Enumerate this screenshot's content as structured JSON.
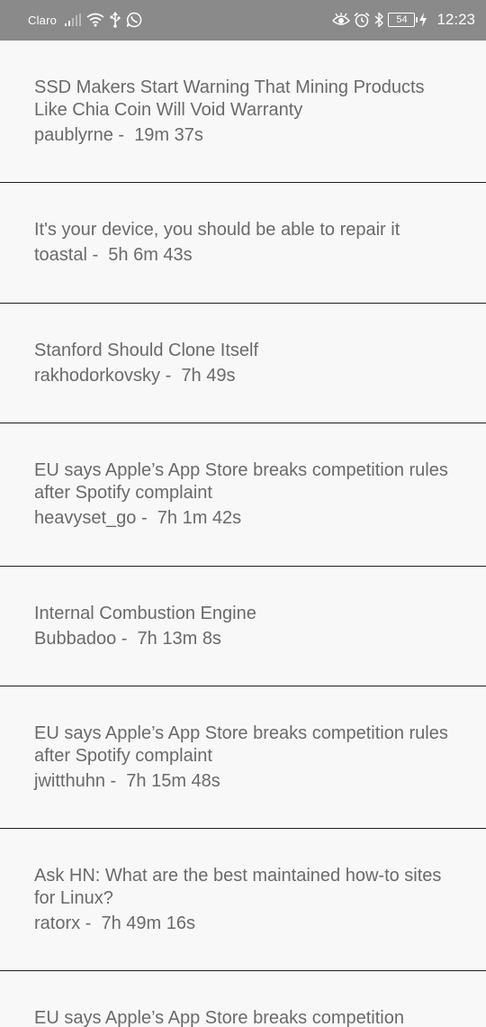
{
  "status_bar": {
    "carrier": "Claro",
    "battery": "54",
    "time": "12:23",
    "icons_left": [
      "signal-icon",
      "wifi-icon",
      "usb-icon",
      "whatsapp-icon"
    ],
    "icons_right": [
      "eye-icon",
      "alarm-icon",
      "bluetooth-icon",
      "battery-icon",
      "charging-icon"
    ]
  },
  "stories": [
    {
      "title": "SSD Makers Start Warning That Mining Products Like Chia Coin Will Void Warranty",
      "author": "paublyrne",
      "separator": " -  ",
      "age": "19m 37s"
    },
    {
      "title": "It's your device, you should be able to repair it",
      "author": "toastal",
      "separator": " -  ",
      "age": "5h 6m 43s"
    },
    {
      "title": "Stanford Should Clone Itself",
      "author": "rakhodorkovsky",
      "separator": " -  ",
      "age": "7h 49s"
    },
    {
      "title": "EU says Apple’s App Store breaks competition rules after Spotify complaint",
      "author": "heavyset_go",
      "separator": " -  ",
      "age": "7h 1m 42s"
    },
    {
      "title": "Internal Combustion Engine",
      "author": "Bubbadoo",
      "separator": " -  ",
      "age": "7h 13m 8s"
    },
    {
      "title": "EU says Apple’s App Store breaks competition rules after Spotify complaint",
      "author": "jwitthuhn",
      "separator": " -  ",
      "age": "7h 15m 48s"
    },
    {
      "title": "Ask HN: What are the best maintained how-to sites for Linux?",
      "author": "ratorx",
      "separator": " -  ",
      "age": "7h 49m 16s"
    },
    {
      "title": "EU says Apple’s App Store breaks competition",
      "author": "",
      "separator": "",
      "age": ""
    }
  ]
}
